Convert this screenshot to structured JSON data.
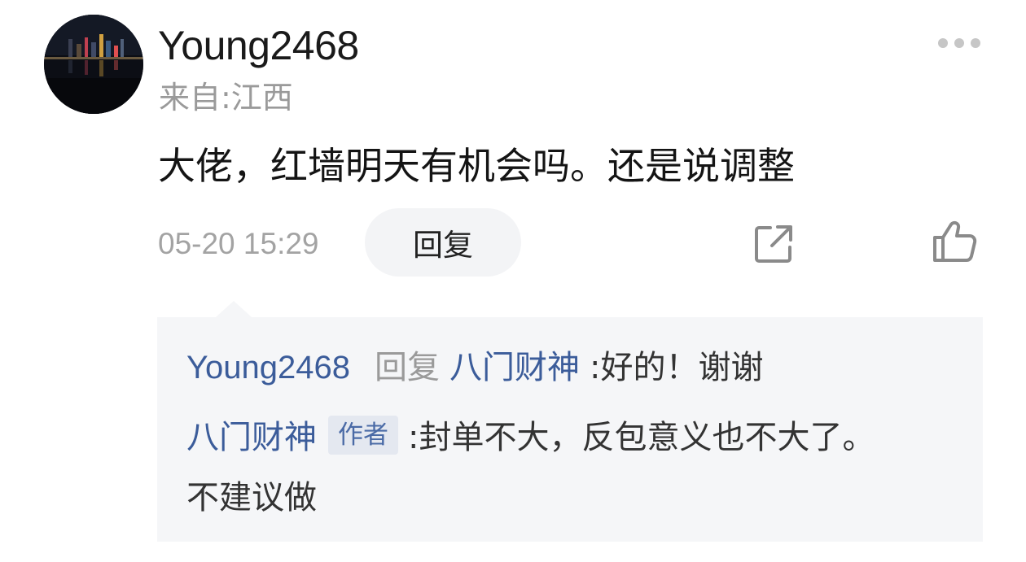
{
  "comment": {
    "username": "Young2468",
    "location": "来自:江西",
    "content": "大佬，红墙明天有机会吗。还是说调整",
    "time": "05-20 15:29",
    "reply_label": "回复",
    "icons": [
      "more-icon",
      "share-icon",
      "like-icon"
    ]
  },
  "replies": {
    "reply1": {
      "from": "Young2468",
      "reply_word": "回复",
      "to": "八门财神",
      "text": "好的！谢谢"
    },
    "reply2": {
      "from": "八门财神",
      "badge": "作者",
      "text_line1": "封单不大，反包意义也不大了。",
      "text_line2": "不建议做"
    }
  },
  "colors": {
    "link": "#3b5c9a",
    "secondary_text": "#9a9a9a",
    "reply_bg": "#f5f6f8",
    "badge_bg": "#e4e8f0"
  }
}
